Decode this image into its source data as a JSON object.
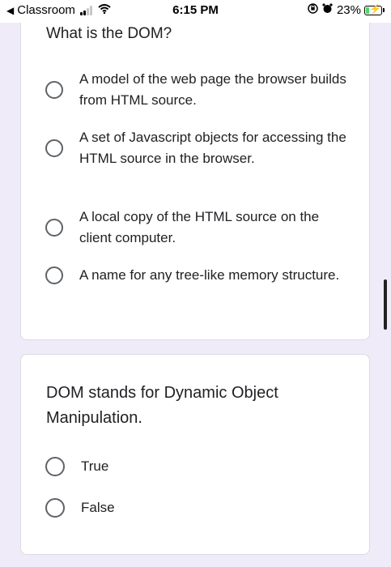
{
  "status_bar": {
    "back_app": "Classroom",
    "time": "6:15 PM",
    "battery_percent": "23%",
    "battery_level": 0.23
  },
  "question1": {
    "text": "What is the DOM?",
    "options": [
      "A model of the web page the browser builds from HTML source.",
      "A set of Javascript objects for accessing the HTML source in the browser.",
      "A local copy of the HTML source on the client computer.",
      "A name for any tree-like memory structure."
    ]
  },
  "question2": {
    "text": "DOM stands for Dynamic Object Manipulation.",
    "options": [
      "True",
      "False"
    ]
  },
  "colors": {
    "background": "#f0ebf8",
    "card": "#ffffff",
    "text": "#202124",
    "radio_border": "#5f6368",
    "battery_charging": "#4cd964"
  }
}
